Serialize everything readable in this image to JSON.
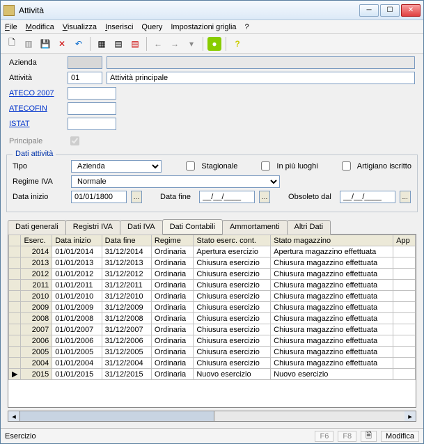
{
  "window": {
    "title": "Attività"
  },
  "menu": {
    "file": "File",
    "modifica": "Modifica",
    "visualizza": "Visualizza",
    "inserisci": "Inserisci",
    "query": "Query",
    "griglia": "Impostazioni griglia",
    "help": "?"
  },
  "toolbar_icons": [
    "new",
    "open",
    "save",
    "delete",
    "undo",
    "grid",
    "filter",
    "nofilter",
    "back",
    "fwd",
    "last",
    "status",
    "help"
  ],
  "form": {
    "azienda_label": "Azienda",
    "azienda_code": "",
    "azienda_desc": "",
    "attivita_label": "Attività",
    "attivita_code": "01",
    "attivita_desc": "Attività principale",
    "ateco2007_label": "ATECO 2007",
    "atecofin_label": "ATECOFIN",
    "istat_label": "ISTAT",
    "principale_label": "Principale",
    "principale_checked": true
  },
  "dati_attivita": {
    "legend": "Dati attività",
    "tipo_label": "Tipo",
    "tipo_value": "Azienda",
    "stagionale_label": "Stagionale",
    "piuluoghi_label": "In più luoghi",
    "artigiano_label": "Artigiano iscritto",
    "regime_label": "Regime IVA",
    "regime_value": "Normale",
    "datainizio_label": "Data inizio",
    "datainizio_value": "01/01/1800",
    "datafine_label": "Data fine",
    "datafine_value": "__/__/____",
    "obsoleto_label": "Obsoleto dal",
    "obsoleto_value": "__/__/____"
  },
  "tabs": [
    {
      "label": "Dati generali",
      "active": false
    },
    {
      "label": "Registri IVA",
      "active": false
    },
    {
      "label": "Dati IVA",
      "active": false
    },
    {
      "label": "Dati Contabili",
      "active": true
    },
    {
      "label": "Ammortamenti",
      "active": false
    },
    {
      "label": "Altri Dati",
      "active": false
    }
  ],
  "grid": {
    "columns": [
      "",
      "Eserc.",
      "Data inizio",
      "Data fine",
      "Regime",
      "Stato eserc. cont.",
      "Stato magazzino",
      "App"
    ],
    "rows": [
      {
        "marker": "",
        "eserc": "2014",
        "inizio": "01/01/2014",
        "fine": "31/12/2014",
        "regime": "Ordinaria",
        "stato": "Apertura esercizio",
        "mag": "Apertura magazzino effettuata"
      },
      {
        "marker": "",
        "eserc": "2013",
        "inizio": "01/01/2013",
        "fine": "31/12/2013",
        "regime": "Ordinaria",
        "stato": "Chiusura esercizio",
        "mag": "Chiusura magazzino effettuata"
      },
      {
        "marker": "",
        "eserc": "2012",
        "inizio": "01/01/2012",
        "fine": "31/12/2012",
        "regime": "Ordinaria",
        "stato": "Chiusura esercizio",
        "mag": "Chiusura magazzino effettuata"
      },
      {
        "marker": "",
        "eserc": "2011",
        "inizio": "01/01/2011",
        "fine": "31/12/2011",
        "regime": "Ordinaria",
        "stato": "Chiusura esercizio",
        "mag": "Chiusura magazzino effettuata"
      },
      {
        "marker": "",
        "eserc": "2010",
        "inizio": "01/01/2010",
        "fine": "31/12/2010",
        "regime": "Ordinaria",
        "stato": "Chiusura esercizio",
        "mag": "Chiusura magazzino effettuata"
      },
      {
        "marker": "",
        "eserc": "2009",
        "inizio": "01/01/2009",
        "fine": "31/12/2009",
        "regime": "Ordinaria",
        "stato": "Chiusura esercizio",
        "mag": "Chiusura magazzino effettuata"
      },
      {
        "marker": "",
        "eserc": "2008",
        "inizio": "01/01/2008",
        "fine": "31/12/2008",
        "regime": "Ordinaria",
        "stato": "Chiusura esercizio",
        "mag": "Chiusura magazzino effettuata"
      },
      {
        "marker": "",
        "eserc": "2007",
        "inizio": "01/01/2007",
        "fine": "31/12/2007",
        "regime": "Ordinaria",
        "stato": "Chiusura esercizio",
        "mag": "Chiusura magazzino effettuata"
      },
      {
        "marker": "",
        "eserc": "2006",
        "inizio": "01/01/2006",
        "fine": "31/12/2006",
        "regime": "Ordinaria",
        "stato": "Chiusura esercizio",
        "mag": "Chiusura magazzino effettuata"
      },
      {
        "marker": "",
        "eserc": "2005",
        "inizio": "01/01/2005",
        "fine": "31/12/2005",
        "regime": "Ordinaria",
        "stato": "Chiusura esercizio",
        "mag": "Chiusura magazzino effettuata"
      },
      {
        "marker": "",
        "eserc": "2004",
        "inizio": "01/01/2004",
        "fine": "31/12/2004",
        "regime": "Ordinaria",
        "stato": "Chiusura esercizio",
        "mag": "Chiusura magazzino effettuata"
      },
      {
        "marker": "▶",
        "eserc": "2015",
        "inizio": "01/01/2015",
        "fine": "31/12/2015",
        "regime": "Ordinaria",
        "stato": "Nuovo esercizio",
        "mag": "Nuovo esercizio"
      }
    ]
  },
  "status": {
    "label": "Esercizio",
    "f6": "F6",
    "f8": "F8",
    "doc": "🗎",
    "mode": "Modifica"
  }
}
